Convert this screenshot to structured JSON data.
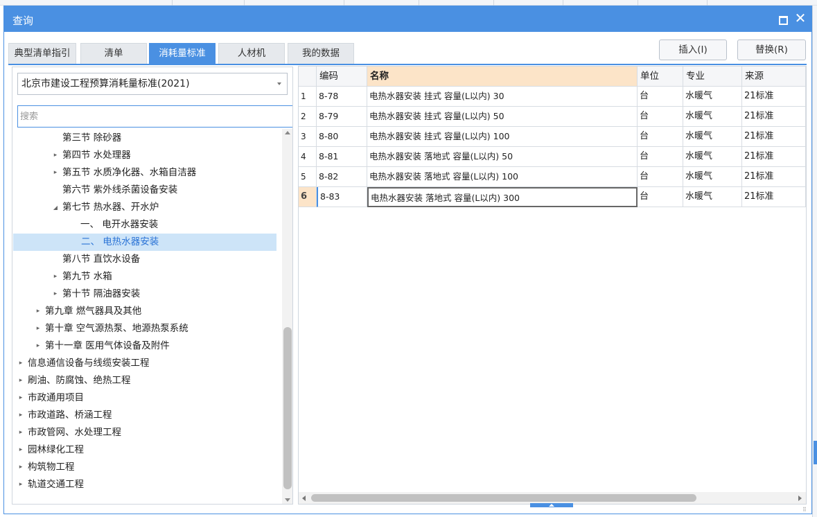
{
  "dialog": {
    "title": "查询",
    "close_glyph": "✕",
    "maximize_icon": "maximize-icon"
  },
  "tabs": [
    {
      "label": "典型清单指引",
      "active": false
    },
    {
      "label": "清单",
      "active": false
    },
    {
      "label": "消耗量标准",
      "active": true
    },
    {
      "label": "人材机",
      "active": false
    },
    {
      "label": "我的数据",
      "active": false
    }
  ],
  "buttons": {
    "insert": "插入(I)",
    "replace": "替换(R)"
  },
  "left": {
    "standard_select": "北京市建设工程预算消耗量标准(2021)",
    "search_placeholder": "搜索"
  },
  "tree": [
    {
      "level": 2,
      "expander": "",
      "label": "第三节 除砂器",
      "selected": false
    },
    {
      "level": 2,
      "expander": "collapsed",
      "label": "第四节 水处理器",
      "selected": false
    },
    {
      "level": 2,
      "expander": "collapsed",
      "label": "第五节 水质净化器、水箱自洁器",
      "selected": false
    },
    {
      "level": 2,
      "expander": "",
      "label": "第六节 紫外线杀菌设备安装",
      "selected": false
    },
    {
      "level": 2,
      "expander": "expanded",
      "label": "第七节 热水器、开水炉",
      "selected": false
    },
    {
      "level": 3,
      "expander": "",
      "label": "一、 电开水器安装",
      "selected": false
    },
    {
      "level": 3,
      "expander": "",
      "label": "二、 电热水器安装",
      "selected": true
    },
    {
      "level": 2,
      "expander": "",
      "label": "第八节 直饮水设备",
      "selected": false
    },
    {
      "level": 2,
      "expander": "collapsed",
      "label": "第九节 水箱",
      "selected": false
    },
    {
      "level": 2,
      "expander": "collapsed",
      "label": "第十节 隔油器安装",
      "selected": false
    },
    {
      "level": 1,
      "expander": "collapsed",
      "label": "第九章 燃气器具及其他",
      "selected": false
    },
    {
      "level": 1,
      "expander": "collapsed",
      "label": "第十章 空气源热泵、地源热泵系统",
      "selected": false
    },
    {
      "level": 1,
      "expander": "collapsed",
      "label": "第十一章 医用气体设备及附件",
      "selected": false
    },
    {
      "level": 0,
      "expander": "collapsed",
      "label": "信息通信设备与线缆安装工程",
      "selected": false
    },
    {
      "level": 0,
      "expander": "collapsed",
      "label": "刷油、防腐蚀、绝热工程",
      "selected": false
    },
    {
      "level": 0,
      "expander": "collapsed",
      "label": "市政通用项目",
      "selected": false
    },
    {
      "level": 0,
      "expander": "collapsed",
      "label": "市政道路、桥涵工程",
      "selected": false
    },
    {
      "level": 0,
      "expander": "collapsed",
      "label": "市政管网、水处理工程",
      "selected": false
    },
    {
      "level": 0,
      "expander": "collapsed",
      "label": "园林绿化工程",
      "selected": false
    },
    {
      "level": 0,
      "expander": "collapsed",
      "label": "构筑物工程",
      "selected": false
    },
    {
      "level": 0,
      "expander": "collapsed",
      "label": "轨道交通工程",
      "selected": false
    }
  ],
  "table": {
    "columns": [
      "",
      "编码",
      "名称",
      "单位",
      "专业",
      "来源"
    ],
    "rows": [
      {
        "idx": "1",
        "code": "8-78",
        "name": "电热水器安装 挂式 容量(L以内) 30",
        "unit": "台",
        "major": "水暖气",
        "source": "21标准"
      },
      {
        "idx": "2",
        "code": "8-79",
        "name": "电热水器安装 挂式 容量(L以内) 50",
        "unit": "台",
        "major": "水暖气",
        "source": "21标准"
      },
      {
        "idx": "3",
        "code": "8-80",
        "name": "电热水器安装 挂式 容量(L以内) 100",
        "unit": "台",
        "major": "水暖气",
        "source": "21标准"
      },
      {
        "idx": "4",
        "code": "8-81",
        "name": "电热水器安装 落地式 容量(L以内) 50",
        "unit": "台",
        "major": "水暖气",
        "source": "21标准"
      },
      {
        "idx": "5",
        "code": "8-82",
        "name": "电热水器安装 落地式 容量(L以内) 100",
        "unit": "台",
        "major": "水暖气",
        "source": "21标准"
      },
      {
        "idx": "6",
        "code": "8-83",
        "name": "电热水器安装 落地式 容量(L以内) 300",
        "unit": "台",
        "major": "水暖气",
        "source": "21标准"
      }
    ],
    "current_row": 6
  },
  "colors": {
    "accent": "#4a90e2",
    "selected_tree_bg": "#cde4f8",
    "header_highlight": "#fce4c8"
  }
}
